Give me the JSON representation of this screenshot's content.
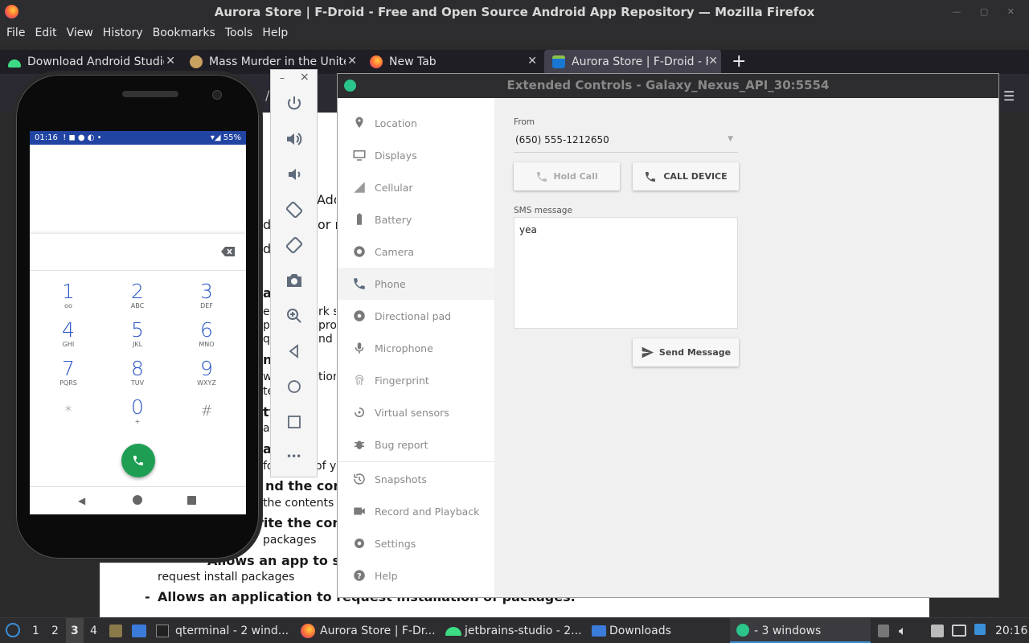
{
  "firefox": {
    "window_title": "Aurora Store | F-Droid - Free and Open Source Android App Repository — Mozilla Firefox",
    "menu": [
      "File",
      "Edit",
      "View",
      "History",
      "Bookmarks",
      "Tools",
      "Help"
    ],
    "tabs": [
      {
        "label": "Download Android Studio",
        "favicon": "android-icon",
        "color": "#3ddc84"
      },
      {
        "label": "Mass Murder in the Unite",
        "favicon": "mask-icon",
        "color": "#c8a060"
      },
      {
        "label": "New Tab",
        "favicon": "firefox-icon",
        "color": "#ff7139"
      },
      {
        "label": "Aurora Store | F-Droid - F",
        "favicon": "fdroid-icon",
        "color": "#1976d2",
        "active": true
      }
    ],
    "new_tab_symbol": "+",
    "url_fragment": "/co"
  },
  "webpage": {
    "fragments": [
      "Add",
      "d",
      "or n",
      "d g",
      "a",
      "ea",
      "rk s",
      "pp",
      "pro",
      "qu",
      "nd",
      "n",
      "w",
      "tion",
      "te",
      "ty",
      "ate",
      "ak",
      "fore",
      "of your shar",
      "nd the contents",
      "the contents",
      "rite the content",
      "packages",
      "Allows an app to see all installed pa",
      "request install packages",
      "Allows an application to request installation of packages."
    ],
    "bullet": "-"
  },
  "phone": {
    "status_time": "01:16",
    "status_icons": "! ◼ ● ◐ •",
    "battery": "55%",
    "keys": [
      {
        "d": "1",
        "l": "ᴏᴏ"
      },
      {
        "d": "2",
        "l": "ABC"
      },
      {
        "d": "3",
        "l": "DEF"
      },
      {
        "d": "4",
        "l": "GHI"
      },
      {
        "d": "5",
        "l": "JKL"
      },
      {
        "d": "6",
        "l": "MNO"
      },
      {
        "d": "7",
        "l": "PQRS"
      },
      {
        "d": "8",
        "l": "TUV"
      },
      {
        "d": "9",
        "l": "WXYZ"
      },
      {
        "d": "*",
        "l": ""
      },
      {
        "d": "0",
        "l": "+"
      },
      {
        "d": "#",
        "l": ""
      }
    ]
  },
  "emulator_toolbar": {
    "min_symbol": "–",
    "close_symbol": "×",
    "icons": [
      "power-icon",
      "volume-up-icon",
      "volume-down-icon",
      "rotate-left-icon",
      "rotate-right-icon",
      "camera-icon",
      "zoom-icon",
      "back-icon",
      "home-icon",
      "overview-icon",
      "more-icon"
    ],
    "more_symbol": "•••"
  },
  "extended_controls": {
    "title": "Extended Controls - Galaxy_Nexus_API_30:5554",
    "sidebar": [
      {
        "label": "Location",
        "icon": "location-icon"
      },
      {
        "label": "Displays",
        "icon": "displays-icon"
      },
      {
        "label": "Cellular",
        "icon": "cellular-icon"
      },
      {
        "label": "Battery",
        "icon": "battery-icon"
      },
      {
        "label": "Camera",
        "icon": "camera-icon"
      },
      {
        "label": "Phone",
        "icon": "phone-icon",
        "selected": true
      },
      {
        "label": "Directional pad",
        "icon": "dpad-icon"
      },
      {
        "label": "Microphone",
        "icon": "microphone-icon"
      },
      {
        "label": "Fingerprint",
        "icon": "fingerprint-icon"
      },
      {
        "label": "Virtual sensors",
        "icon": "sensors-icon"
      },
      {
        "label": "Bug report",
        "icon": "bug-icon"
      },
      {
        "label": "Snapshots",
        "icon": "snapshots-icon"
      },
      {
        "label": "Record and Playback",
        "icon": "record-icon"
      },
      {
        "label": "Settings",
        "icon": "settings-icon"
      },
      {
        "label": "Help",
        "icon": "help-icon"
      }
    ],
    "phone_panel": {
      "from_label": "From",
      "from_value": "(650) 555-1212650",
      "hold_call": "Hold Call",
      "call_device": "CALL DEVICE",
      "sms_label": "SMS message",
      "sms_value": "yea",
      "send_message": "Send Message"
    }
  },
  "taskbar": {
    "workspaces": [
      "1",
      "2",
      "3",
      "4"
    ],
    "active_workspace": "3",
    "items": [
      {
        "label": "qterminal - 2 wind..."
      },
      {
        "label": "Aurora Store | F-Dr..."
      },
      {
        "label": "jetbrains-studio - 2..."
      },
      {
        "label": "Downloads"
      },
      {
        "label": "- 3 windows"
      }
    ],
    "clock": "20:16"
  }
}
